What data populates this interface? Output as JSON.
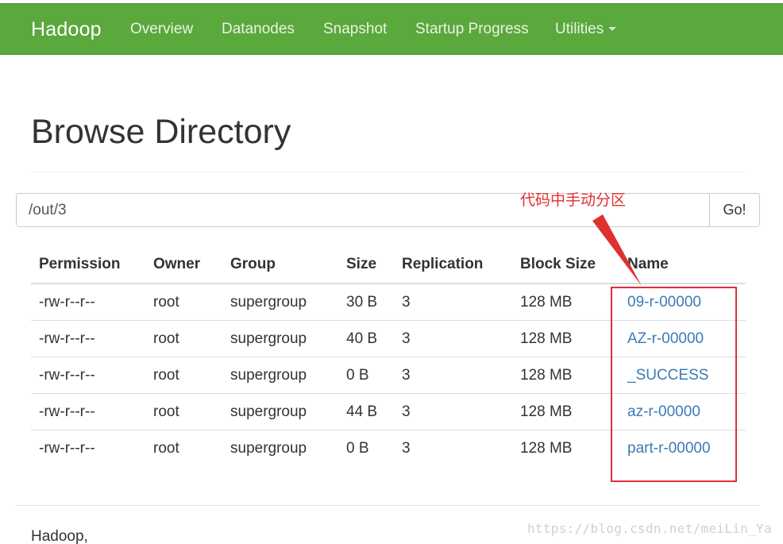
{
  "navbar": {
    "brand": "Hadoop",
    "items": [
      "Overview",
      "Datanodes",
      "Snapshot",
      "Startup Progress",
      "Utilities"
    ]
  },
  "heading": "Browse Directory",
  "path": {
    "value": "/out/3",
    "button": "Go!"
  },
  "table": {
    "columns": [
      "Permission",
      "Owner",
      "Group",
      "Size",
      "Replication",
      "Block Size",
      "Name"
    ],
    "rows": [
      [
        "-rw-r--r--",
        "root",
        "supergroup",
        "30 B",
        "3",
        "128 MB",
        "09-r-00000"
      ],
      [
        "-rw-r--r--",
        "root",
        "supergroup",
        "40 B",
        "3",
        "128 MB",
        "AZ-r-00000"
      ],
      [
        "-rw-r--r--",
        "root",
        "supergroup",
        "0 B",
        "3",
        "128 MB",
        "_SUCCESS"
      ],
      [
        "-rw-r--r--",
        "root",
        "supergroup",
        "44 B",
        "3",
        "128 MB",
        "az-r-00000"
      ],
      [
        "-rw-r--r--",
        "root",
        "supergroup",
        "0 B",
        "3",
        "128 MB",
        "part-r-00000"
      ]
    ]
  },
  "annotation": {
    "text": "代码中手动分区",
    "color": "#e03038"
  },
  "footer": "Hadoop,",
  "watermark": "https://blog.csdn.net/meiLin_Ya",
  "colors": {
    "navbar": "#5ba83d",
    "link": "#3c7ab8"
  }
}
